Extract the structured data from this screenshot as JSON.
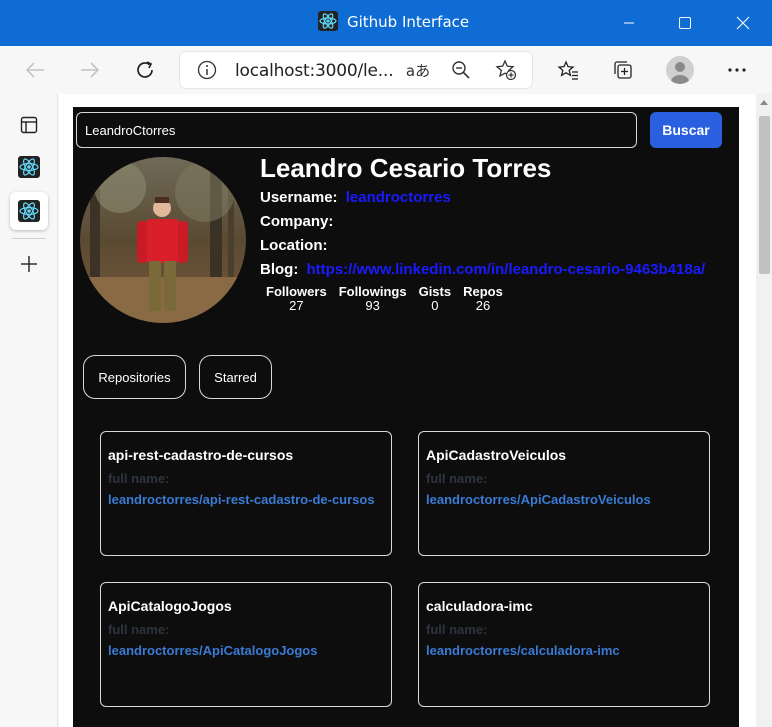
{
  "window": {
    "title": "Github Interface"
  },
  "browser": {
    "url": "localhost:3000/le...",
    "icons": [
      "back-icon",
      "forward-icon",
      "refresh-icon",
      "info-icon",
      "read-aloud-icon",
      "zoom-out-icon",
      "add-favorite-icon",
      "favorites-icon",
      "collections-icon",
      "profile-avatar",
      "more-icon"
    ]
  },
  "sidebar": {
    "icons": [
      "tab-actions-icon",
      "react-app-icon",
      "react-app-icon-active",
      "add-icon"
    ]
  },
  "search": {
    "value": "LeandroCtorres",
    "button_label": "Buscar"
  },
  "profile": {
    "name": "Leandro Cesario Torres",
    "username_label": "Username:",
    "username": "leandroctorres",
    "company_label": "Company:",
    "company": "",
    "location_label": "Location:",
    "location": "",
    "blog_label": "Blog:",
    "blog": "https://www.linkedin.com/in/leandro-cesario-9463b418a/",
    "stats": [
      {
        "label": "Followers",
        "value": "27"
      },
      {
        "label": "Followings",
        "value": "93"
      },
      {
        "label": "Gists",
        "value": "0"
      },
      {
        "label": "Repos",
        "value": "26"
      }
    ]
  },
  "tabs": [
    {
      "label": "Repositories"
    },
    {
      "label": "Starred"
    }
  ],
  "repos": [
    {
      "name": "api-rest-cadastro-de-cursos",
      "full_name_label": "full name:",
      "full_name": "leandroctorres/api-rest-cadastro-de-cursos"
    },
    {
      "name": "ApiCadastroVeiculos",
      "full_name_label": "full name:",
      "full_name": "leandroctorres/ApiCadastroVeiculos"
    },
    {
      "name": "ApiCatalogoJogos",
      "full_name_label": "full name:",
      "full_name": "leandroctorres/ApiCatalogoJogos"
    },
    {
      "name": "calculadora-imc",
      "full_name_label": "full name:",
      "full_name": "leandroctorres/calculadora-imc"
    }
  ],
  "colors": {
    "titlebar": "#0f6cd4",
    "accent_button": "#2a5fe0",
    "app_background": "#0d0d0d",
    "link": "#1a1aff",
    "repo_link": "#3a7bd5"
  }
}
